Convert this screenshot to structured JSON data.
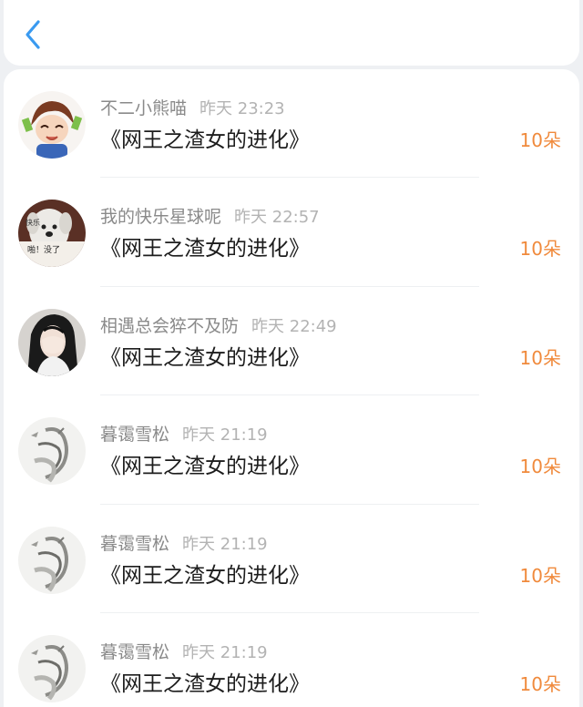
{
  "header": {
    "back_icon": "chevron-left-icon",
    "accent": "#3a9af0"
  },
  "records": [
    {
      "nickname": "不二小熊喵",
      "time": "昨天 23:23",
      "book": "《网王之渣女的进化》",
      "amount": "10朵",
      "avatar": "anime-boy-avatar"
    },
    {
      "nickname": "我的快乐星球呢",
      "time": "昨天 22:57",
      "book": "《网王之渣女的进化》",
      "amount": "10朵",
      "avatar": "dog-meme-avatar",
      "avatar_text": [
        "快乐",
        "啪！没了"
      ]
    },
    {
      "nickname": "相遇总会猝不及防",
      "time": "昨天 22:49",
      "book": "《网王之渣女的进化》",
      "amount": "10朵",
      "avatar": "girl-photo-avatar"
    },
    {
      "nickname": "暮霭雪松",
      "time": "昨天 21:19",
      "book": "《网王之渣女的进化》",
      "amount": "10朵",
      "avatar": "ink-sketch-avatar"
    },
    {
      "nickname": "暮霭雪松",
      "time": "昨天 21:19",
      "book": "《网王之渣女的进化》",
      "amount": "10朵",
      "avatar": "ink-sketch-avatar"
    },
    {
      "nickname": "暮霭雪松",
      "time": "昨天 21:19",
      "book": "《网王之渣女的进化》",
      "amount": "10朵",
      "avatar": "ink-sketch-avatar"
    }
  ],
  "colors": {
    "amount": "#f08a3c",
    "nickname": "#8a8a8a",
    "time": "#b3b3b3",
    "title": "#1d1d1d"
  }
}
